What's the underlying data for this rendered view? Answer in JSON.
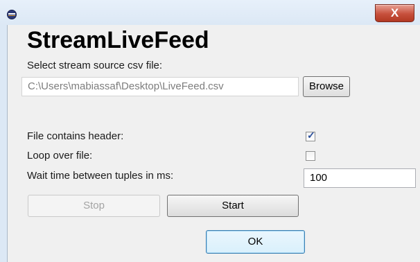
{
  "window": {
    "close_glyph": "X",
    "app_icon": "eclipse-icon"
  },
  "title": "StreamLiveFeed",
  "source": {
    "label": "Select stream source csv file:",
    "path": "C:\\Users\\mabiassaf\\Desktop\\LiveFeed.csv",
    "browse_label": "Browse"
  },
  "options": {
    "header_label": "File contains header:",
    "header_checked": true,
    "loop_label": "Loop over file:",
    "loop_checked": false,
    "wait_label": "Wait time between tuples in ms:",
    "wait_value": "100"
  },
  "buttons": {
    "stop": "Stop",
    "start": "Start",
    "ok": "OK"
  },
  "colors": {
    "close_red": "#c7503c",
    "ok_border": "#3c7fb1",
    "check": "#2a4f9c"
  }
}
